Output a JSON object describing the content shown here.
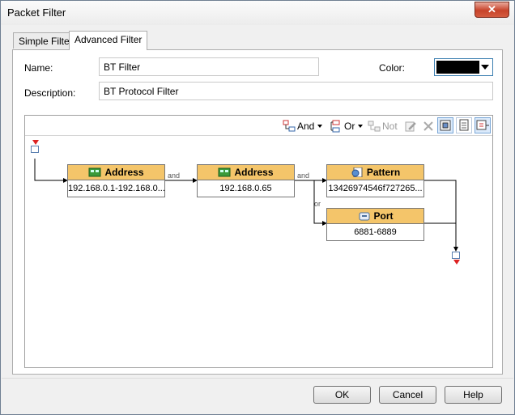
{
  "window": {
    "title": "Packet Filter",
    "close_label": "✕"
  },
  "tabs": [
    {
      "label": "Simple Filter",
      "active": false
    },
    {
      "label": "Advanced Filter",
      "active": true
    }
  ],
  "form": {
    "name_label": "Name:",
    "name_value": "BT Filter",
    "description_label": "Description:",
    "description_value": "BT Protocol Filter",
    "color_label": "Color:",
    "color_value": "#000000"
  },
  "toolbar": {
    "and_label": "And",
    "or_label": "Or",
    "not_label": "Not"
  },
  "nodes": {
    "address1": {
      "title": "Address",
      "value": "192.168.0.1-192.168.0..."
    },
    "address2": {
      "title": "Address",
      "value": "192.168.0.65"
    },
    "pattern": {
      "title": "Pattern",
      "value": "13426974546f727265..."
    },
    "port": {
      "title": "Port",
      "value": "6881-6889"
    }
  },
  "connectors": {
    "and1": "and",
    "and2": "and",
    "or1": "or"
  },
  "buttons": {
    "ok": "OK",
    "cancel": "Cancel",
    "help": "Help"
  },
  "colors": {
    "node_header": "#f4c56a",
    "accent": "#3c7fb1"
  }
}
